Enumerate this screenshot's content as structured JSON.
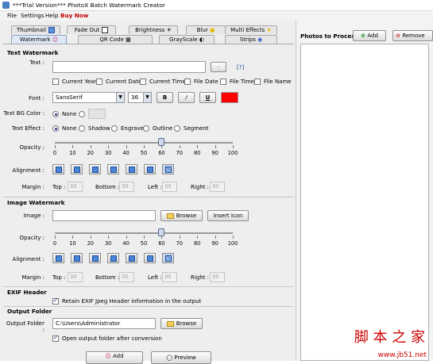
{
  "window": {
    "title": "***Trial Version*** PhotoX Batch Watermark Creator"
  },
  "menu": {
    "file": "File",
    "settings": "Settings",
    "help": "Help",
    "buy_now": "Buy Now"
  },
  "tabs_row1": [
    "Thumbnail",
    "Fade Out",
    "Brightness",
    "Blur",
    "Multi Effects"
  ],
  "tabs_row2": [
    "Watermark",
    "QR Code",
    "GrayScale",
    "Strips"
  ],
  "text_watermark": {
    "section": "Text Watermark",
    "text_label": "Text :",
    "text_value": "",
    "help": "[?]",
    "checkboxes": [
      "Current Year",
      "Current Date",
      "Current Time",
      "File Date",
      "File Time",
      "File Name"
    ],
    "font_label": "Font :",
    "font_value": "SansSerif",
    "size_value": "36",
    "bold": "B",
    "italic": "/",
    "underline": "U",
    "font_color": "#ff0000",
    "bg_label": "Text BG Color :",
    "bg_none": "None",
    "effect_label": "Text Effect :",
    "effects": [
      "None",
      "Shadow",
      "Engrave",
      "Outline",
      "Segment"
    ],
    "opacity_label": "Opacity :",
    "opacity_value": 60,
    "opacity_ticks": [
      "0",
      "10",
      "20",
      "30",
      "40",
      "50",
      "60",
      "70",
      "80",
      "90",
      "100"
    ],
    "alignment_label": "Alignment :",
    "alignment_selected": 6,
    "margin_label": "Margin :",
    "margins": [
      {
        "label": "Top :",
        "value": "30"
      },
      {
        "label": "Bottom :",
        "value": "30"
      },
      {
        "label": "Left :",
        "value": "30"
      },
      {
        "label": "Right :",
        "value": "30"
      }
    ]
  },
  "image_watermark": {
    "section": "Image Watermark",
    "image_label": "Image :",
    "image_value": "",
    "browse": "Browse",
    "insert_icon": "Insert Icon",
    "opacity_label": "Opacity :",
    "opacity_value": 60,
    "opacity_ticks": [
      "0",
      "10",
      "20",
      "30",
      "40",
      "50",
      "60",
      "70",
      "80",
      "90",
      "100"
    ],
    "alignment_label": "Alignment :",
    "alignment_selected": 6,
    "margin_label": "Margin :",
    "margins": [
      {
        "label": "Top :",
        "value": "30"
      },
      {
        "label": "Bottom :",
        "value": "30"
      },
      {
        "label": "Left :",
        "value": "30"
      },
      {
        "label": "Right :",
        "value": "30"
      }
    ]
  },
  "exif": {
    "section": "EXIF Header",
    "retain": "Retain EXIF Jpeg Header information in the output",
    "retain_checked": true
  },
  "output": {
    "section": "Output Folder",
    "folder_label": "Output Folder :",
    "folder_value": "C:\\Users\\Administrator",
    "browse": "Browse",
    "open_after": "Open output folder after conversion",
    "open_checked": true
  },
  "bottom_buttons": {
    "add": "Add",
    "preview": "Preview"
  },
  "right": {
    "title": "Photos to Process",
    "add": "Add",
    "remove": "Remove"
  },
  "overlay": {
    "text": "脚 本 之 家",
    "url": "www.jb51.net"
  }
}
